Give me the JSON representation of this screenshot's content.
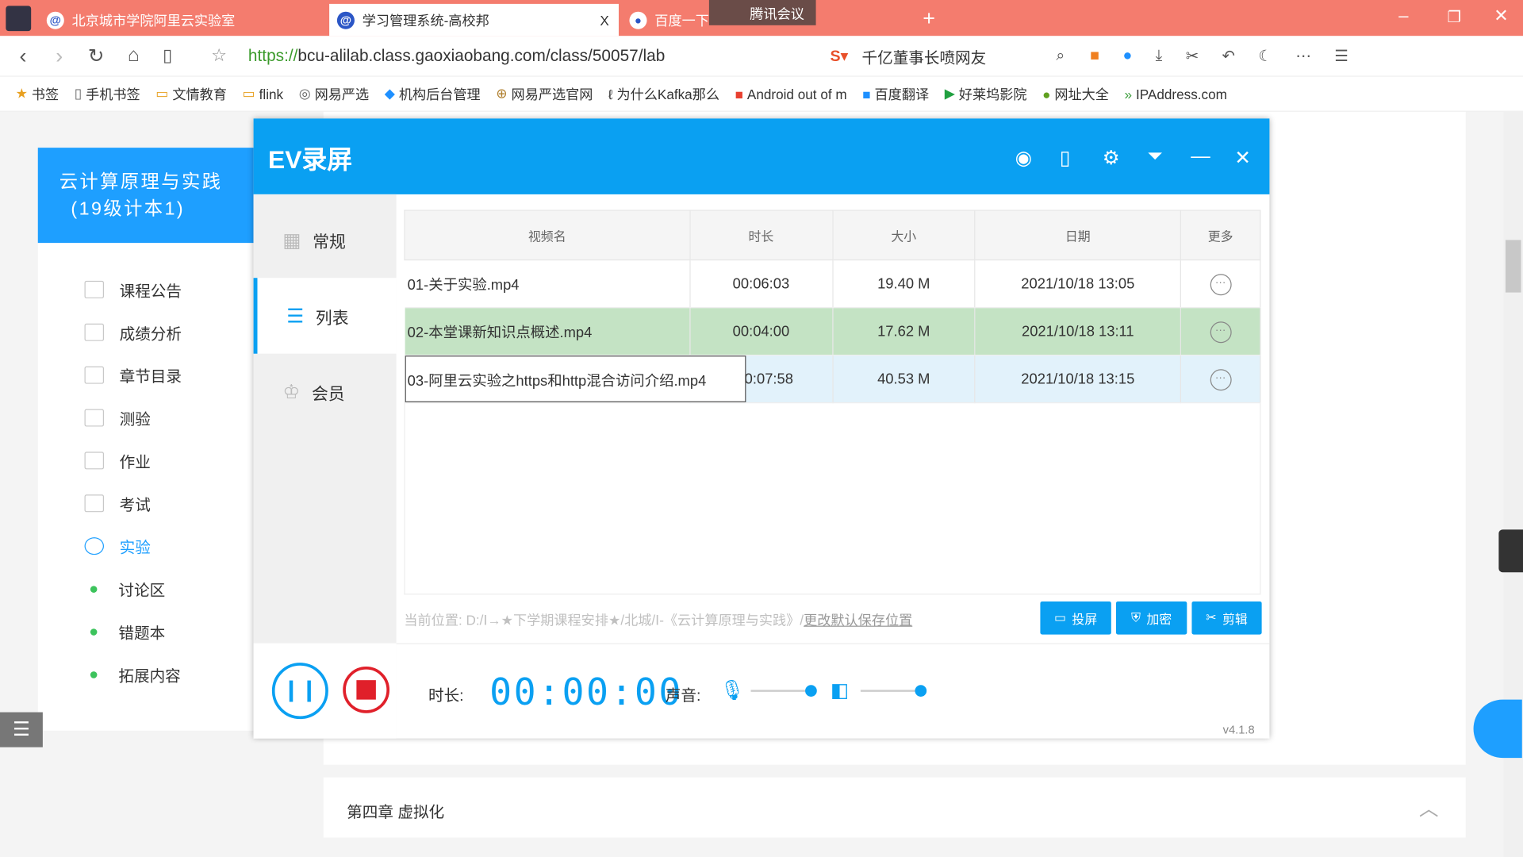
{
  "browser": {
    "tabs": [
      {
        "label": "北京城市学院阿里云实验室"
      },
      {
        "label": "学习管理系统-高校邦",
        "close": "X"
      },
      {
        "label": "百度一下"
      }
    ],
    "overlay": "腾讯会议",
    "url_scheme": "https://",
    "url_rest": "bcu-alilab.class.gaoxiaobang.com/class/50057/lab",
    "search_text": "千亿董事长喷网友",
    "bookmarks": [
      "书签",
      "手机书签",
      "文情教育",
      "flink",
      "网易严选",
      "机构后台管理",
      "网易严选官网",
      "为什么Kafka那么",
      "Android out of m",
      "百度翻译",
      "好莱坞影院",
      "网址大全",
      "IPAddress.com"
    ]
  },
  "page": {
    "course_title": "云计算原理与实践",
    "course_sub": "(19级计本1)",
    "sidebar": [
      {
        "label": "课程公告"
      },
      {
        "label": "成绩分析"
      },
      {
        "label": "章节目录"
      },
      {
        "label": "测验"
      },
      {
        "label": "作业"
      },
      {
        "label": "考试"
      },
      {
        "label": "实验",
        "active": true
      },
      {
        "label": "讨论区"
      },
      {
        "label": "错题本"
      },
      {
        "label": "拓展内容"
      }
    ],
    "chapter": "第四章 虚拟化",
    "accent": "#1e9fff"
  },
  "recorder": {
    "title": "EV录屏",
    "nav": [
      {
        "label": "常规"
      },
      {
        "label": "列表",
        "active": true
      },
      {
        "label": "会员"
      }
    ],
    "columns": [
      "视频名",
      "时长",
      "大小",
      "日期",
      "更多"
    ],
    "rows": [
      {
        "name": "01-关于实验.mp4",
        "duration": "00:06:03",
        "size": "19.40 M",
        "date": "2021/10/18 13:05"
      },
      {
        "name": "02-本堂课新知识点概述.mp4",
        "duration": "00:04:00",
        "size": "17.62 M",
        "date": "2021/10/18 13:11",
        "selected": true
      },
      {
        "name": "03-阿里云实验之https和http混合访问介绍.mp4",
        "duration": "0:07:58",
        "size": "40.53 M",
        "date": "2021/10/18 13:15",
        "editing": true
      }
    ],
    "path_label": "当前位置: D:/Ⅰ→★下学期课程安排★/北城/Ⅰ-《云计算原理与实践》/",
    "change_path": "更改默认保存位置",
    "actions": [
      "投屏",
      "加密",
      "剪辑"
    ],
    "duration_label": "时长:",
    "timer": "00:00:00",
    "sound_label": "声音:",
    "mic_level": 1.0,
    "speaker_level": 1.0,
    "version": "v4.1.8",
    "accent": "#0aa0f2",
    "record_color": "#e0202a"
  }
}
